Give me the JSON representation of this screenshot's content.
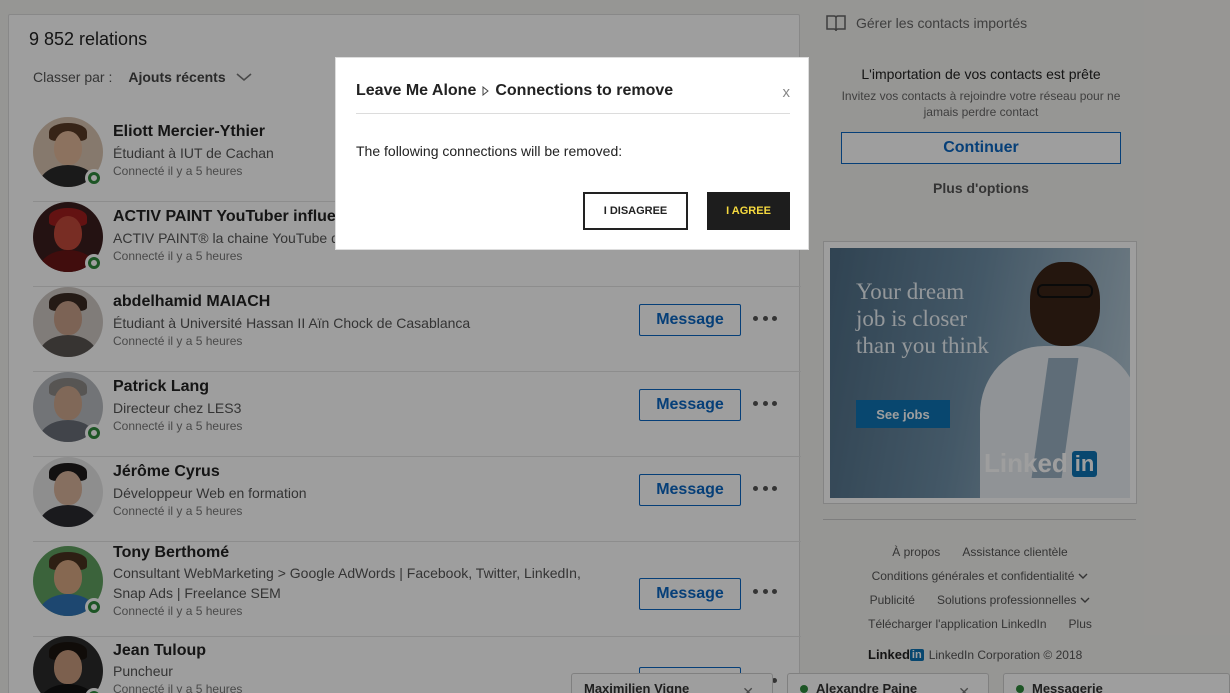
{
  "connections": {
    "count_label": "9 852 relations",
    "sort_label": "Classer par :",
    "sort_value": "Ajouts récents",
    "message_label": "Message",
    "items": [
      {
        "name": "Eliott Mercier-Ythier",
        "headline": "Étudiant à IUT de Cachan",
        "since": "Connecté il y a 5 heures",
        "online": true
      },
      {
        "name": "ACTIV PAINT YouTuber influe",
        "headline": "ACTIV PAINT® la chaine YouTube d",
        "since": "Connecté il y a 5 heures",
        "online": true
      },
      {
        "name": "abdelhamid MAIACH",
        "headline": "Étudiant à Université Hassan II Aïn Chock de Casablanca",
        "since": "Connecté il y a 5 heures",
        "online": false
      },
      {
        "name": "Patrick Lang",
        "headline": "Directeur chez LES3",
        "since": "Connecté il y a 5 heures",
        "online": true
      },
      {
        "name": "Jérôme Cyrus",
        "headline": "Développeur Web en formation",
        "since": "Connecté il y a 5 heures",
        "online": false
      },
      {
        "name": "Tony Berthomé",
        "headline": "Consultant WebMarketing > Google AdWords | Facebook, Twitter, LinkedIn,",
        "headline2": "Snap Ads | Freelance SEM",
        "since": "Connecté il y a 5 heures",
        "online": true
      },
      {
        "name": "Jean Tuloup",
        "headline": "Puncheur",
        "since": "Connecté il y a 5 heures",
        "online": true
      }
    ]
  },
  "sidebar": {
    "manage_label": "Gérer les contacts importés",
    "import_title": "L'importation de vos contacts est prête",
    "import_sub": "Invitez vos contacts à rejoindre votre réseau pour ne jamais perdre contact",
    "continue_label": "Continuer",
    "more_options": "Plus d'options"
  },
  "ad": {
    "text": "Your dream job is closer than you think",
    "button": "See jobs",
    "logo_text": "Linked",
    "logo_in": "in"
  },
  "footer": {
    "links": [
      "À propos",
      "Assistance clientèle",
      "Conditions générales et confidentialité",
      "Publicité",
      "Solutions professionnelles",
      "Télécharger l'application LinkedIn",
      "Plus"
    ],
    "brand_logo": "Linked",
    "brand_in": "in",
    "brand_text": "LinkedIn Corporation © 2018"
  },
  "chat_tabs": [
    "Maximilien Vigne",
    "Alexandre Paine",
    "Messagerie"
  ],
  "modal": {
    "title_app": "Leave Me Alone",
    "title_page": "Connections to remove",
    "close": "x",
    "message": "The following connections will be removed:",
    "disagree": "I DISAGREE",
    "agree": "I AGREE"
  },
  "colors": {
    "accent": "#0a66c2",
    "online": "#2f8a3c",
    "agree_bg": "#1d1d1d",
    "agree_text": "#f5d93f"
  }
}
